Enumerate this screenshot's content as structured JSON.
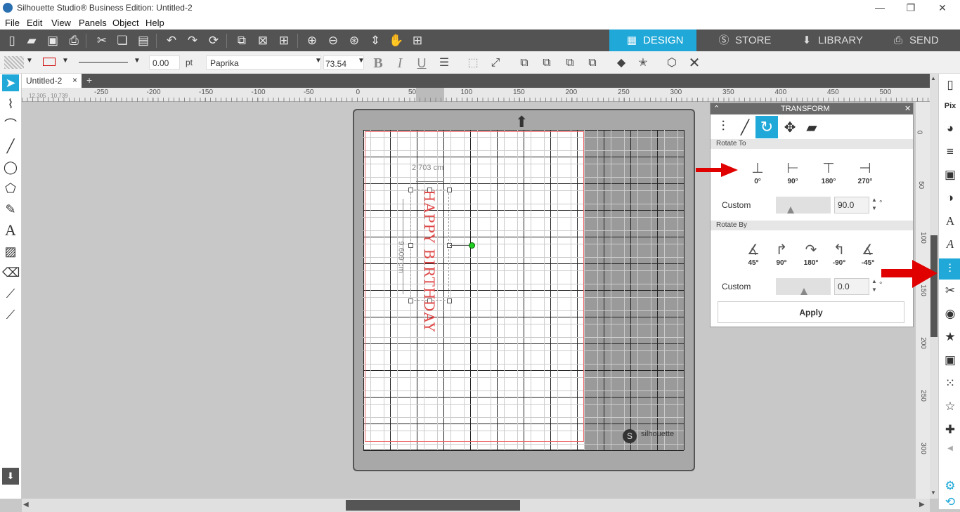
{
  "window": {
    "title": "Silhouette Studio® Business Edition: Untitled-2"
  },
  "menu": [
    "File",
    "Edit",
    "View",
    "Panels",
    "Object",
    "Help"
  ],
  "nav_tabs": [
    {
      "label": "DESIGN"
    },
    {
      "label": "STORE"
    },
    {
      "label": "LIBRARY"
    },
    {
      "label": "SEND"
    }
  ],
  "toolbar2": {
    "line_width": "0.00",
    "unit": "pt",
    "font_name": "Paprika",
    "font_size": "73.54",
    "bold": "B",
    "italic": "I",
    "underline": "U"
  },
  "doc_tab": {
    "title": "Untitled-2",
    "close": "×",
    "add": "+"
  },
  "coords": "12.305 , 10.739",
  "ruler_h": [
    "-250",
    "-200",
    "-150",
    "-100",
    "-50",
    "0",
    "50",
    "100",
    "150",
    "200",
    "250",
    "300",
    "350",
    "400",
    "450",
    "500"
  ],
  "ruler_v": [
    "0",
    "50",
    "100",
    "150",
    "200",
    "250",
    "300"
  ],
  "design": {
    "width_label": "2.703 cm",
    "height_label": "9.609 cm",
    "text": "HAPPY BIRTHDAY",
    "brand": "silhouette"
  },
  "transform": {
    "title": "TRANSFORM",
    "rotate_to_label": "Rotate To",
    "rotate_to": [
      "0°",
      "90°",
      "180°",
      "270°"
    ],
    "custom_label": "Custom",
    "custom_to_value": "90.0",
    "degree": "°",
    "rotate_by_label": "Rotate By",
    "rotate_by": [
      "45°",
      "90°",
      "180°",
      "-90°",
      "-45°"
    ],
    "custom_by_value": "0.0",
    "apply_label": "Apply"
  },
  "colors": {
    "accent": "#1fa8d8",
    "annotation_arrow": "#e00000",
    "text_red": "#e04848"
  }
}
